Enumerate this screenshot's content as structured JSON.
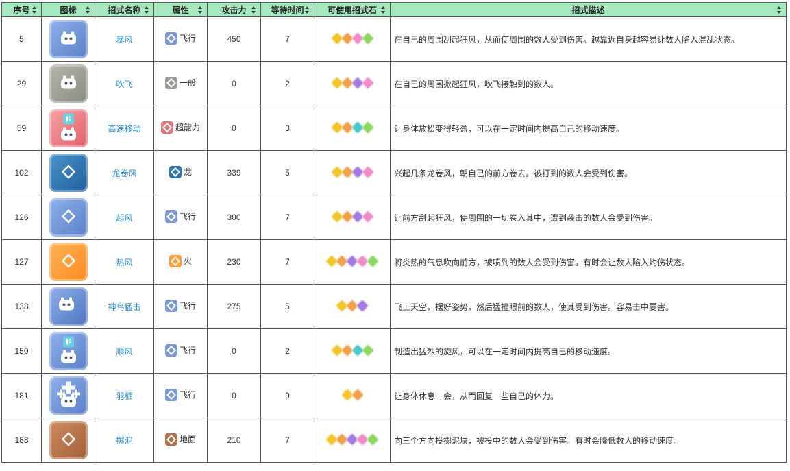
{
  "headers": {
    "num": "序号",
    "icon": "图标",
    "name": "招式名称",
    "attr": "属性",
    "atk": "攻击力",
    "wait": "等待时间",
    "stones": "可使用招式石",
    "desc": "招式描述"
  },
  "colors": {
    "header_bg": "#a6e8bf",
    "link": "#2a90d0",
    "flying": "#7b98d6",
    "normal": "#9a9a90",
    "psychic": "#e9737a",
    "dragon": "#2f76b2",
    "fire": "#ff9c3a",
    "ground": "#b0714a",
    "stone_yellow": "#f2c52a",
    "stone_orange": "#f4a04a",
    "stone_purple": "#a37be0",
    "stone_pink": "#f08cc8",
    "stone_green": "#8cd85e",
    "stone_teal": "#4cc8c8"
  },
  "rows": [
    {
      "num": "5",
      "name": "暴风",
      "attr": "飞行",
      "attr_icon": "flying-type-icon",
      "atk": "450",
      "wait": "7",
      "icon": "gale-move-icon",
      "desc": "在自己的周围刮起狂风，从而使周围的数人受到伤害。越靠近自身越容易让数人陷入混乱状态。",
      "stones": [
        "yellow",
        "orange",
        "pink",
        "green"
      ]
    },
    {
      "num": "29",
      "name": "吹飞",
      "attr": "一般",
      "attr_icon": "normal-type-icon",
      "atk": "0",
      "wait": "2",
      "icon": "whirlwind-move-icon",
      "desc": "在自己的周围掀起狂风，吹飞接触到的数人。",
      "stones": [
        "yellow",
        "orange",
        "purple",
        "pink"
      ]
    },
    {
      "num": "59",
      "name": "高速移动",
      "attr": "超能力",
      "attr_icon": "psychic-type-icon",
      "atk": "0",
      "wait": "3",
      "icon": "agility-move-icon",
      "desc": "让身体放松变得轻盈，可以在一定时间内提高自己的移动速度。",
      "stones": [
        "yellow",
        "orange",
        "teal",
        "green"
      ]
    },
    {
      "num": "102",
      "name": "龙卷风",
      "attr": "龙",
      "attr_icon": "dragon-type-icon",
      "atk": "339",
      "wait": "5",
      "icon": "twister-move-icon",
      "desc": "兴起几条龙卷风，朝自己的前方卷去。被打到的数人会受到伤害。",
      "stones": [
        "yellow",
        "orange",
        "purple",
        "pink"
      ]
    },
    {
      "num": "126",
      "name": "起风",
      "attr": "飞行",
      "attr_icon": "flying-type-icon",
      "atk": "300",
      "wait": "7",
      "icon": "gust-move-icon",
      "desc": "让前方刮起狂风，使周围的一切卷入其中，遭到袭击的数人会受到伤害。",
      "stones": [
        "yellow",
        "orange",
        "purple",
        "pink"
      ]
    },
    {
      "num": "127",
      "name": "热风",
      "attr": "火",
      "attr_icon": "fire-type-icon",
      "atk": "230",
      "wait": "7",
      "icon": "heat-wave-move-icon",
      "desc": "将炎热的气息吹向前方，被喷到的数人会受到伤害。有时会让数人陷入灼伤状态。",
      "stones": [
        "yellow",
        "orange",
        "purple",
        "pink",
        "green"
      ]
    },
    {
      "num": "138",
      "name": "神鸟猛击",
      "attr": "飞行",
      "attr_icon": "flying-type-icon",
      "atk": "275",
      "wait": "5",
      "icon": "sky-attack-move-icon",
      "desc": "飞上天空，摆好姿势，然后猛撞眼前的数人，使其受到伤害。容易击中要害。",
      "stones": [
        "yellow",
        "orange",
        "purple"
      ]
    },
    {
      "num": "150",
      "name": "顺风",
      "attr": "飞行",
      "attr_icon": "flying-type-icon",
      "atk": "0",
      "wait": "2",
      "icon": "tailwind-move-icon",
      "desc": "制造出猛烈的旋风，可以在一定时间内提高自己的移动速度。",
      "stones": [
        "yellow",
        "orange",
        "teal",
        "green"
      ]
    },
    {
      "num": "181",
      "name": "羽栖",
      "attr": "飞行",
      "attr_icon": "flying-type-icon",
      "atk": "0",
      "wait": "9",
      "icon": "roost-move-icon",
      "desc": "让身体休息一会，从而回复一些自己的体力。",
      "stones": [
        "yellow",
        "orange"
      ]
    },
    {
      "num": "188",
      "name": "掷泥",
      "attr": "地面",
      "attr_icon": "ground-type-icon",
      "atk": "210",
      "wait": "7",
      "icon": "mud-shot-move-icon",
      "desc": "向三个方向投掷泥块，被投中的数人会受到伤害。有时会降低数人的移动速度。",
      "stones": [
        "yellow",
        "orange",
        "purple",
        "pink",
        "green"
      ]
    }
  ]
}
